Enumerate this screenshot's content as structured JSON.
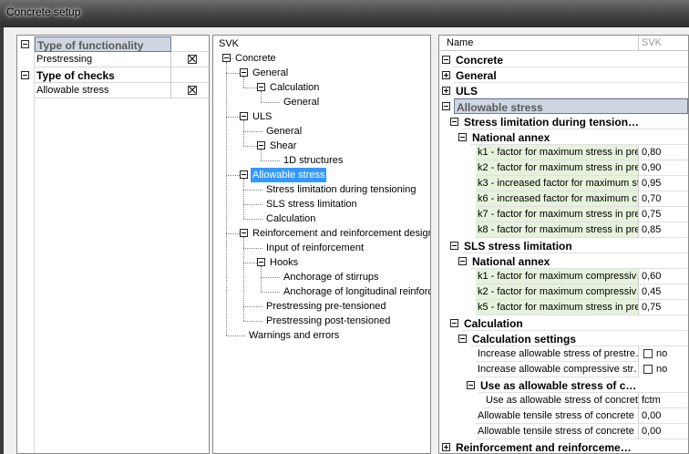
{
  "window": {
    "title": "Concrete setup"
  },
  "left": {
    "rows": [
      {
        "label": "Type of functionality",
        "kind": "category",
        "selected": true
      },
      {
        "label": "Prestressing",
        "kind": "item",
        "checked": true
      },
      {
        "label": "Type of checks",
        "kind": "category"
      },
      {
        "label": "Allowable stress",
        "kind": "item",
        "checked": true
      }
    ]
  },
  "tree": {
    "header": "SVK",
    "nodes": [
      {
        "label": "Concrete",
        "depth": 0,
        "exp": "minus"
      },
      {
        "label": "General",
        "depth": 1,
        "exp": "minus"
      },
      {
        "label": "Calculation",
        "depth": 2,
        "exp": "minus"
      },
      {
        "label": "General",
        "depth": 3
      },
      {
        "label": "ULS",
        "depth": 1,
        "exp": "minus"
      },
      {
        "label": "General",
        "depth": 2
      },
      {
        "label": "Shear",
        "depth": 2,
        "exp": "minus"
      },
      {
        "label": "1D structures",
        "depth": 3
      },
      {
        "label": "Allowable stress",
        "depth": 1,
        "exp": "minus",
        "selected": true
      },
      {
        "label": "Stress limitation during tensioning",
        "depth": 2
      },
      {
        "label": "SLS stress limitation",
        "depth": 2
      },
      {
        "label": "Calculation",
        "depth": 2
      },
      {
        "label": "Reinforcement and reinforcement design",
        "depth": 1,
        "exp": "minus"
      },
      {
        "label": "Input of reinforcement",
        "depth": 2
      },
      {
        "label": "Hooks",
        "depth": 2,
        "exp": "minus"
      },
      {
        "label": "Anchorage of stirrups",
        "depth": 3
      },
      {
        "label": "Anchorage of longitudinal reinforc",
        "depth": 3
      },
      {
        "label": "Prestressing pre-tensioned",
        "depth": 2
      },
      {
        "label": "Prestressing post-tensioned",
        "depth": 2
      },
      {
        "label": "Warnings and errors",
        "depth": 1
      }
    ]
  },
  "props": {
    "col_name": "Name",
    "col_value": "SVK",
    "rows": [
      {
        "label": "Concrete",
        "kind": "group",
        "depth": 0,
        "exp": "minus"
      },
      {
        "label": "General",
        "kind": "group",
        "depth": 0,
        "exp": "plus"
      },
      {
        "label": "ULS",
        "kind": "group",
        "depth": 0,
        "exp": "plus"
      },
      {
        "label": "Allowable stress",
        "kind": "group",
        "depth": 0,
        "exp": "minus",
        "selected": true
      },
      {
        "label": "Stress limitation during tension…",
        "kind": "group",
        "depth": 1,
        "exp": "minus"
      },
      {
        "label": "National annex",
        "kind": "group",
        "depth": 2,
        "exp": "minus"
      },
      {
        "label": "k1 - factor for maximum stress in pre…",
        "kind": "leaf",
        "depth": 3,
        "value": "0,80"
      },
      {
        "label": "k2 - factor for maximum stress in pre…",
        "kind": "leaf",
        "depth": 3,
        "value": "0,90"
      },
      {
        "label": "k3 - increased factor for maximum st…",
        "kind": "leaf",
        "depth": 3,
        "value": "0,95"
      },
      {
        "label": "k6 - increased factor for maximum c…",
        "kind": "leaf",
        "depth": 3,
        "value": "0,70"
      },
      {
        "label": "k7 - factor for maximum stress in pre…",
        "kind": "leaf",
        "depth": 3,
        "value": "0,75"
      },
      {
        "label": "k8 - factor for maximum stress in pre…",
        "kind": "leaf",
        "depth": 3,
        "value": "0,85"
      },
      {
        "label": "SLS stress limitation",
        "kind": "group",
        "depth": 1,
        "exp": "minus"
      },
      {
        "label": "National annex",
        "kind": "group",
        "depth": 2,
        "exp": "minus"
      },
      {
        "label": "k1 - factor for maximum compressiv…",
        "kind": "leaf",
        "depth": 3,
        "value": "0,60"
      },
      {
        "label": "k2 - factor for maximum compressiv…",
        "kind": "leaf",
        "depth": 3,
        "value": "0,45"
      },
      {
        "label": "k5 - factor for maximum stress in pre…",
        "kind": "leaf",
        "depth": 3,
        "value": "0,75"
      },
      {
        "label": "Calculation",
        "kind": "group",
        "depth": 1,
        "exp": "minus"
      },
      {
        "label": "Calculation settings",
        "kind": "group",
        "depth": 2,
        "exp": "minus"
      },
      {
        "label": "Increase allowable stress of prestre…",
        "kind": "leaf",
        "plain": true,
        "depth": 3,
        "check": true,
        "value": "no"
      },
      {
        "label": "Increase allowable compressive str…",
        "kind": "leaf",
        "plain": true,
        "depth": 3,
        "check": true,
        "value": "no"
      },
      {
        "label": "Use as allowable stress of c…",
        "kind": "group",
        "depth": 3,
        "exp": "minus"
      },
      {
        "label": "Use as allowable stress of concret…",
        "kind": "leaf",
        "plain": true,
        "depth": 4,
        "value": "fctm"
      },
      {
        "label": "Allowable tensile stress of concrete …",
        "kind": "leaf",
        "plain": true,
        "depth": 3,
        "value": "0,00"
      },
      {
        "label": "Allowable tensile stress of concrete …",
        "kind": "leaf",
        "plain": true,
        "depth": 3,
        "value": "0,00"
      },
      {
        "label": "Reinforcement and reinforceme…",
        "kind": "group",
        "depth": 0,
        "exp": "plus"
      }
    ]
  }
}
